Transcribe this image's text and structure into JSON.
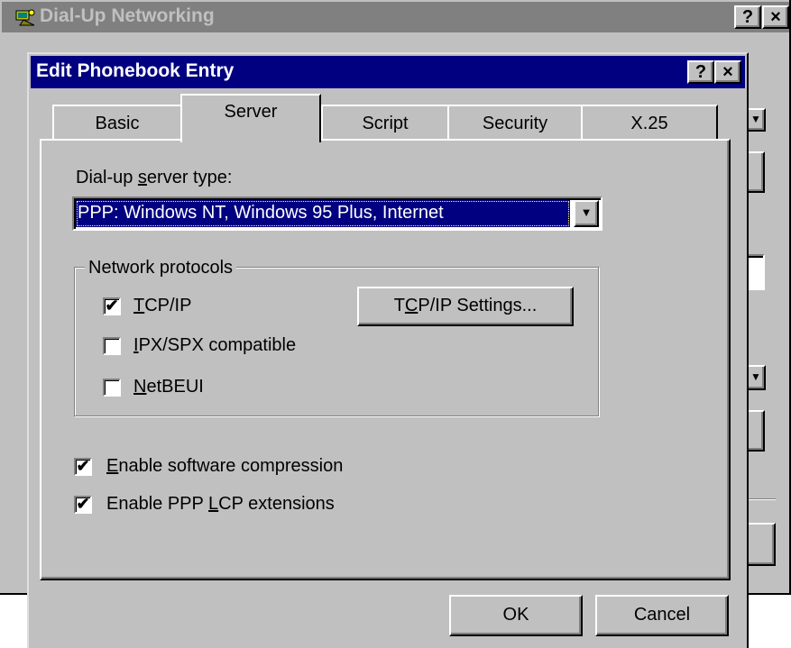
{
  "background_window": {
    "title": "Dial-Up Networking",
    "help_button": "?",
    "close_button": "×"
  },
  "dialog": {
    "title": "Edit Phonebook Entry",
    "help_button": "?",
    "close_button": "×",
    "tabs": [
      {
        "label": "Basic",
        "active": false
      },
      {
        "label": "Server",
        "active": true
      },
      {
        "label": "Script",
        "active": false
      },
      {
        "label": "Security",
        "active": false
      },
      {
        "label": "X.25",
        "active": false
      }
    ],
    "server_type": {
      "label_prefix": "Dial-up ",
      "label_underlined": "s",
      "label_suffix": "erver type:",
      "selected": "PPP: Windows NT, Windows 95 Plus, Internet"
    },
    "protocols": {
      "group_label": "Network protocols",
      "items": [
        {
          "underlined": "T",
          "rest": "CP/IP",
          "checked": true
        },
        {
          "underlined": "I",
          "rest": "PX/SPX compatible",
          "checked": false
        },
        {
          "underlined": "N",
          "rest": "etBEUI",
          "checked": false
        }
      ],
      "settings_button": {
        "prefix": "T",
        "underlined": "C",
        "suffix": "P/IP Settings..."
      }
    },
    "options": [
      {
        "prefix": "",
        "underlined": "E",
        "suffix": "nable software compression",
        "checked": true
      },
      {
        "prefix": "Enable PPP ",
        "underlined": "L",
        "suffix": "CP extensions",
        "checked": true
      }
    ],
    "ok_button": "OK",
    "cancel_button": "Cancel",
    "check_glyph": "✔"
  }
}
